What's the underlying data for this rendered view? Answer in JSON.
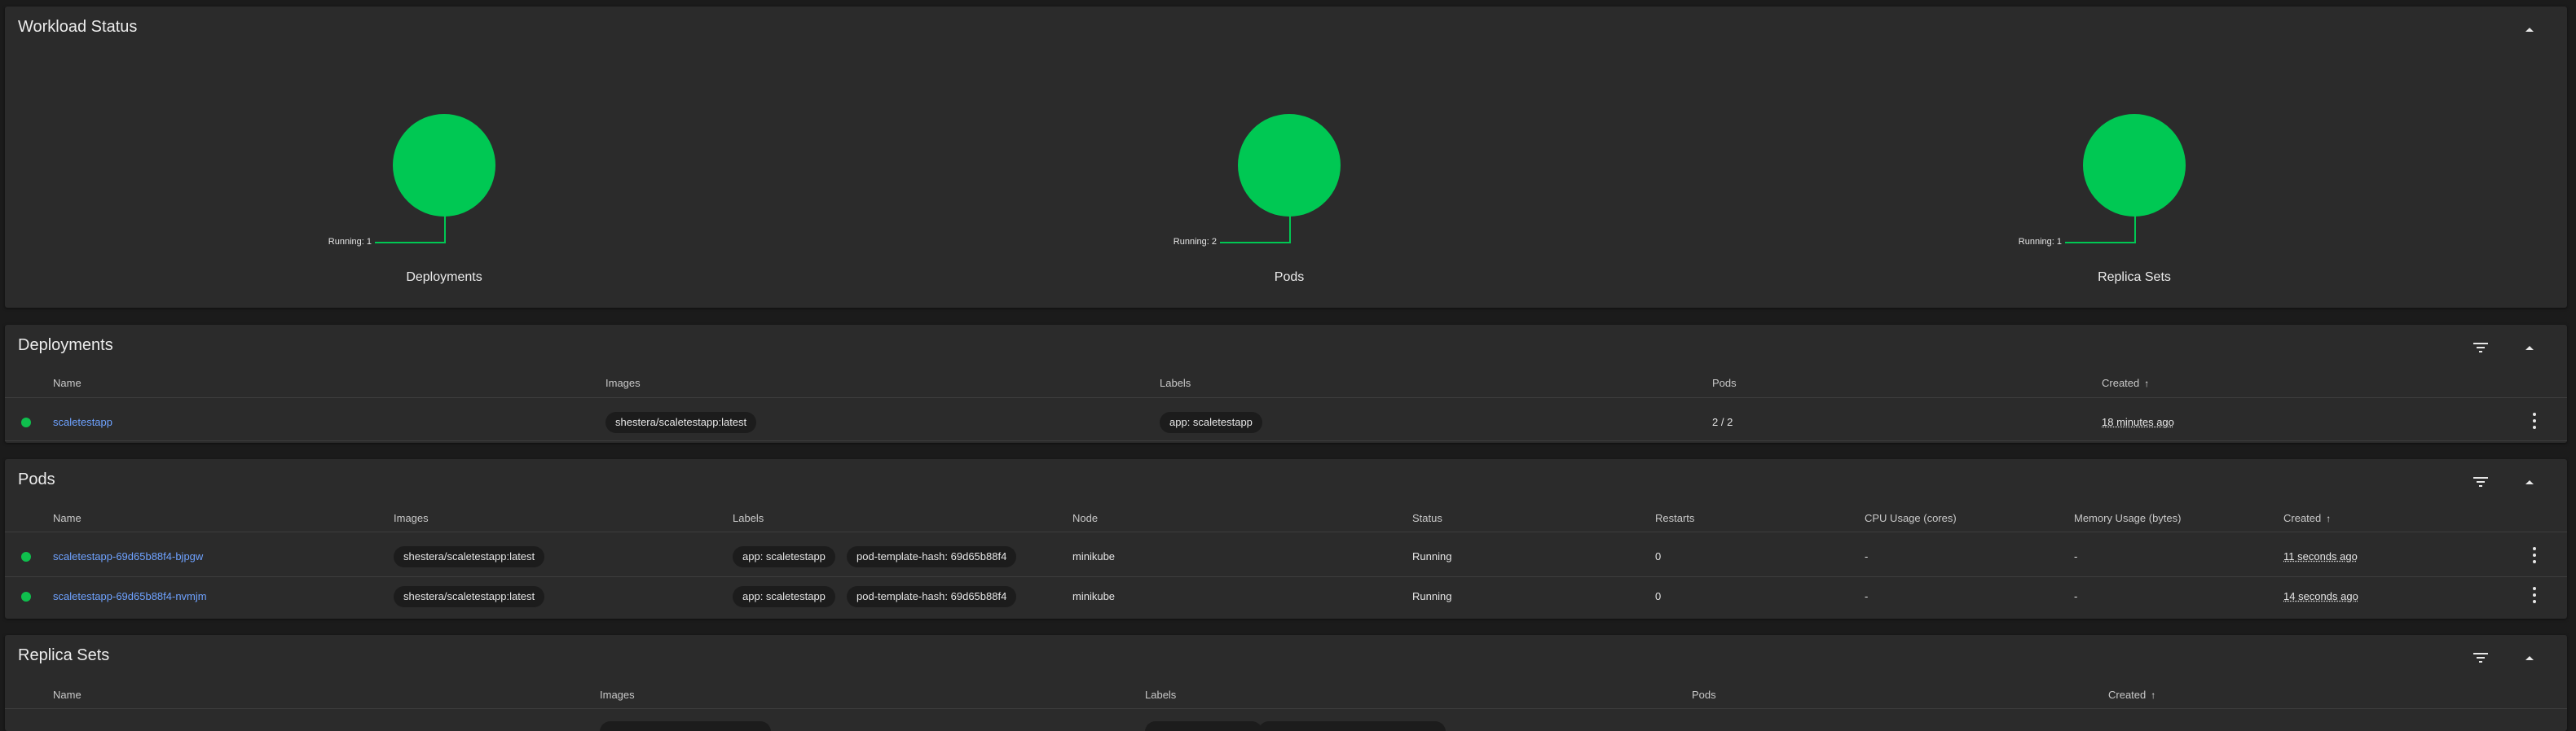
{
  "colors": {
    "background": "#1b1b1b",
    "card": "#2b2b2b",
    "running": "#00c853",
    "link": "#6ea2ff"
  },
  "workload_status": {
    "title": "Workload Status",
    "collapse_icon": "chevron-up-icon",
    "charts": [
      {
        "label": "Deployments",
        "running_text": "Running: 1",
        "running": 1
      },
      {
        "label": "Pods",
        "running_text": "Running: 2",
        "running": 2
      },
      {
        "label": "Replica Sets",
        "running_text": "Running: 1",
        "running": 1
      }
    ]
  },
  "deployments": {
    "title": "Deployments",
    "filter_icon": "filter-icon",
    "collapse_icon": "chevron-up-icon",
    "columns": [
      "Name",
      "Images",
      "Labels",
      "Pods",
      "Created"
    ],
    "sort_icon": "arrow-up-icon",
    "rows": [
      {
        "status": "running",
        "name": "scaletestapp",
        "images": [
          "shestera/scaletestapp:latest"
        ],
        "labels": [
          "app: scaletestapp"
        ],
        "pods": "2 / 2",
        "created": "18 minutes ago"
      }
    ]
  },
  "pods": {
    "title": "Pods",
    "filter_icon": "filter-icon",
    "collapse_icon": "chevron-up-icon",
    "columns": [
      "Name",
      "Images",
      "Labels",
      "Node",
      "Status",
      "Restarts",
      "CPU Usage (cores)",
      "Memory Usage (bytes)",
      "Created"
    ],
    "sort_icon": "arrow-up-icon",
    "rows": [
      {
        "status": "running",
        "name": "scaletestapp-69d65b88f4-bjpgw",
        "images": [
          "shestera/scaletestapp:latest"
        ],
        "labels": [
          "app: scaletestapp",
          "pod-template-hash: 69d65b88f4"
        ],
        "node": "minikube",
        "status_text": "Running",
        "restarts": "0",
        "cpu": "-",
        "memory": "-",
        "created": "11 seconds ago"
      },
      {
        "status": "running",
        "name": "scaletestapp-69d65b88f4-nvmjm",
        "images": [
          "shestera/scaletestapp:latest"
        ],
        "labels": [
          "app: scaletestapp",
          "pod-template-hash: 69d65b88f4"
        ],
        "node": "minikube",
        "status_text": "Running",
        "restarts": "0",
        "cpu": "-",
        "memory": "-",
        "created": "14 seconds ago"
      }
    ]
  },
  "replica_sets": {
    "title": "Replica Sets",
    "filter_icon": "filter-icon",
    "collapse_icon": "chevron-up-icon",
    "columns": [
      "Name",
      "Images",
      "Labels",
      "Pods",
      "Created"
    ],
    "sort_icon": "arrow-up-icon"
  }
}
